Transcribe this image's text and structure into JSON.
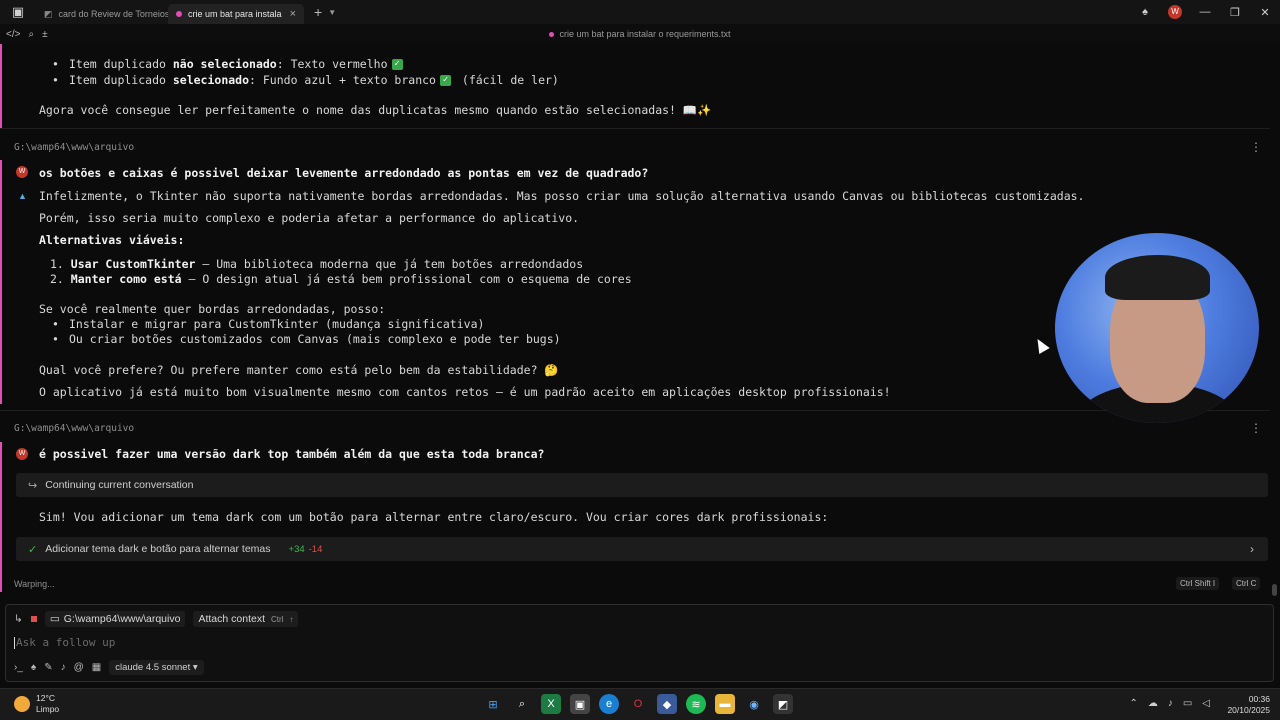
{
  "tabs": [
    {
      "label": "card do Review de Torneios",
      "active": false
    },
    {
      "label": "crie um bat para instalar o req",
      "active": true
    }
  ],
  "user_initial": "W",
  "file_title": "crie um bat para instalar o requeriments.txt",
  "block1": {
    "bullet1_a": "Item duplicado ",
    "bullet1_b": "não selecionado",
    "bullet1_c": ": Texto vermelho",
    "bullet2_a": "Item duplicado ",
    "bullet2_b": "selecionado",
    "bullet2_c": ": Fundo azul + texto branco",
    "bullet2_d": "(fácil de ler)",
    "summary": "Agora você consegue ler perfeitamente o nome das duplicatas mesmo quando estão selecionadas! 📖✨"
  },
  "block2": {
    "path": "G:\\wamp64\\www\\arquivo",
    "question": "os botões e caixas é possivel deixar levemente arredondado as pontas em vez de quadrado?",
    "answer1": "Infelizmente, o Tkinter não suporta nativamente bordas arredondadas. Mas posso criar uma solução alternativa usando Canvas ou bibliotecas customizadas.",
    "answer2": "Porém, isso seria muito complexo e poderia afetar a performance do aplicativo.",
    "alt_heading": "Alternativas viáveis:",
    "alt1_num": "1.",
    "alt1_bold": "Usar CustomTkinter",
    "alt1_rest": " – Uma biblioteca moderna que já tem botões arredondados",
    "alt2_num": "2.",
    "alt2_bold": "Manter como está",
    "alt2_rest": " – O design atual já está bem profissional com o esquema de cores",
    "if_line": "Se você realmente quer bordas arredondadas, posso:",
    "opt1": "Instalar e migrar para CustomTkinter (mudança significativa)",
    "opt2": "Ou criar botões customizados com Canvas (mais complexo e pode ter bugs)",
    "prefer": "Qual você prefere? Ou prefere manter como está pelo bem da estabilidade? 🤔",
    "closing": "O aplicativo já está muito bom visualmente mesmo com cantos retos – é um padrão aceito em aplicações desktop profissionais!"
  },
  "block3": {
    "path": "G:\\wamp64\\www\\arquivo",
    "question": "é possivel fazer uma versão dark top também além da que esta toda branca?",
    "continuing": "Continuing current conversation",
    "answer": "Sim! Vou adicionar um tema dark com um botão para alternar entre claro/escuro. Vou criar cores dark profissionais:",
    "task_label": "Adicionar tema dark e botão para alternar temas",
    "task_plus": "+34",
    "task_minus": "-14"
  },
  "status": {
    "warping": "Warping...",
    "shortcut1": "Ctrl Shift I",
    "shortcut2": "Ctrl C"
  },
  "input": {
    "path_chip": "G:\\wamp64\\www\\arquivo",
    "attach": "Attach context",
    "attach_kbd": "Ctrl",
    "placeholder": "Ask a follow up",
    "model": "claude 4.5 sonnet"
  },
  "taskbar": {
    "temp": "12°C",
    "weather": "Limpo",
    "time": "00:36",
    "date": "20/10/2025"
  },
  "colors": {
    "accent": "#e04fb5",
    "user_avatar": "#c4372b",
    "plus": "#3fb955",
    "minus": "#e05050"
  }
}
